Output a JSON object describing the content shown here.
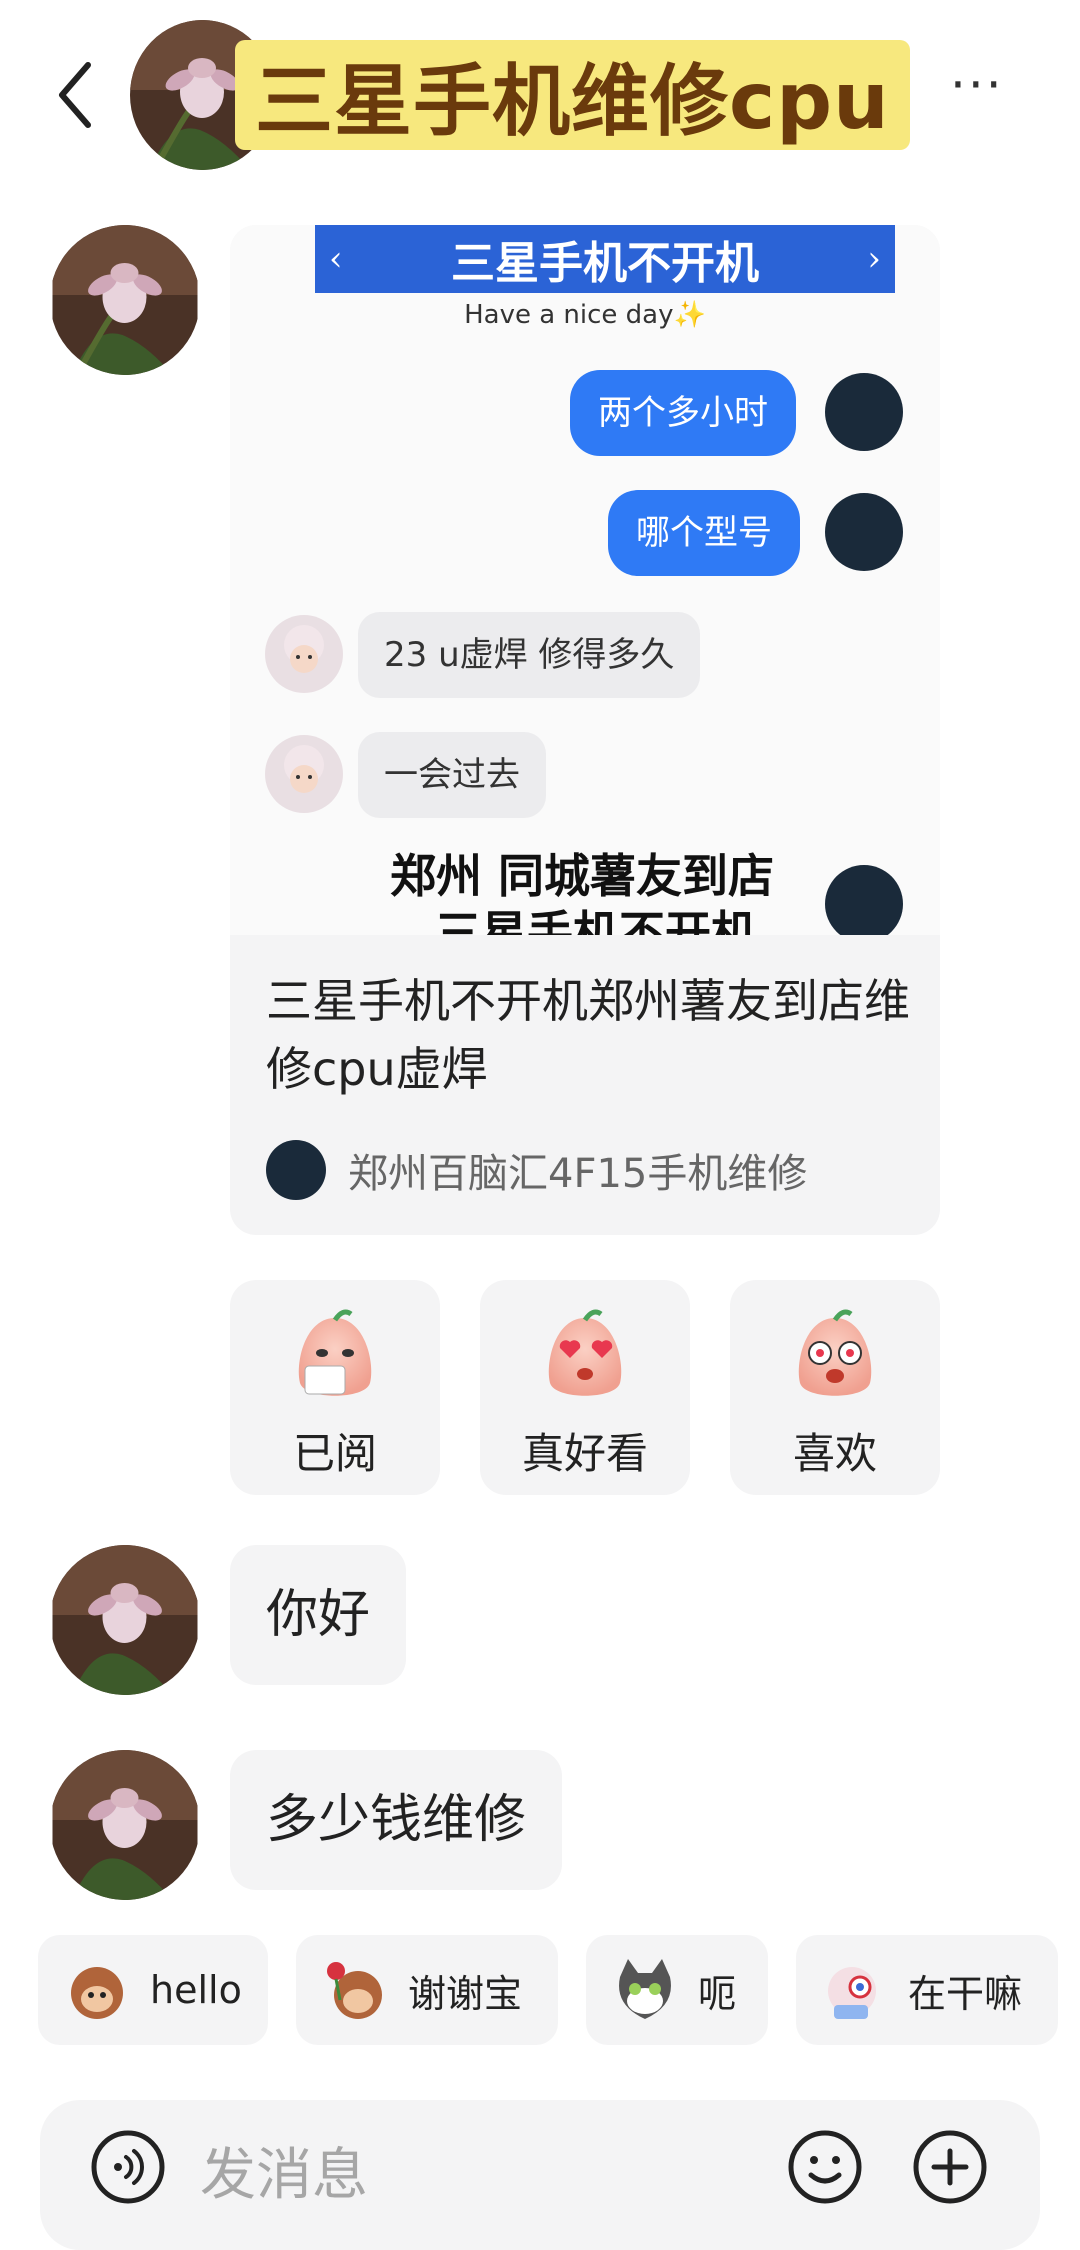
{
  "header": {
    "title": "三星手机维修cpu",
    "more": "···"
  },
  "card": {
    "image": {
      "banner": "三星手机不开机",
      "banner_left": "‹",
      "banner_right": "›",
      "subtitle": "Have a nice day✨",
      "bubbles_right": [
        "两个多小时",
        "哪个型号"
      ],
      "bubbles_left": [
        "23  u虚焊 修得多久",
        "一会过去"
      ],
      "overlay_line1": "郑州  同城薯友到店",
      "overlay_line2": "三星手机不开机"
    },
    "title": "三星手机不开机郑州薯友到店维修cpu虚焊",
    "author": "郑州百脑汇4F15手机维修"
  },
  "reactions": [
    {
      "label": "已阅",
      "icon": "peach-reading-emoji-icon"
    },
    {
      "label": "真好看",
      "icon": "peach-heart-eyes-emoji-icon"
    },
    {
      "label": "喜欢",
      "icon": "peach-star-eyes-emoji-icon"
    }
  ],
  "messages": [
    "你好",
    "多少钱维修"
  ],
  "quick_replies": [
    {
      "label": "hello",
      "icon": "monkey-wave-icon"
    },
    {
      "label": "谢谢宝",
      "icon": "monkey-rose-icon"
    },
    {
      "label": "呃",
      "icon": "cat-awkward-icon"
    },
    {
      "label": "在干嘛",
      "icon": "peeking-character-icon"
    }
  ],
  "input": {
    "placeholder": "发消息"
  },
  "colors": {
    "title_highlight": "#f7e87e",
    "title_text": "#6a3a0c",
    "bubble_blue": "#2f7af5",
    "card_bg": "#f4f4f5"
  }
}
